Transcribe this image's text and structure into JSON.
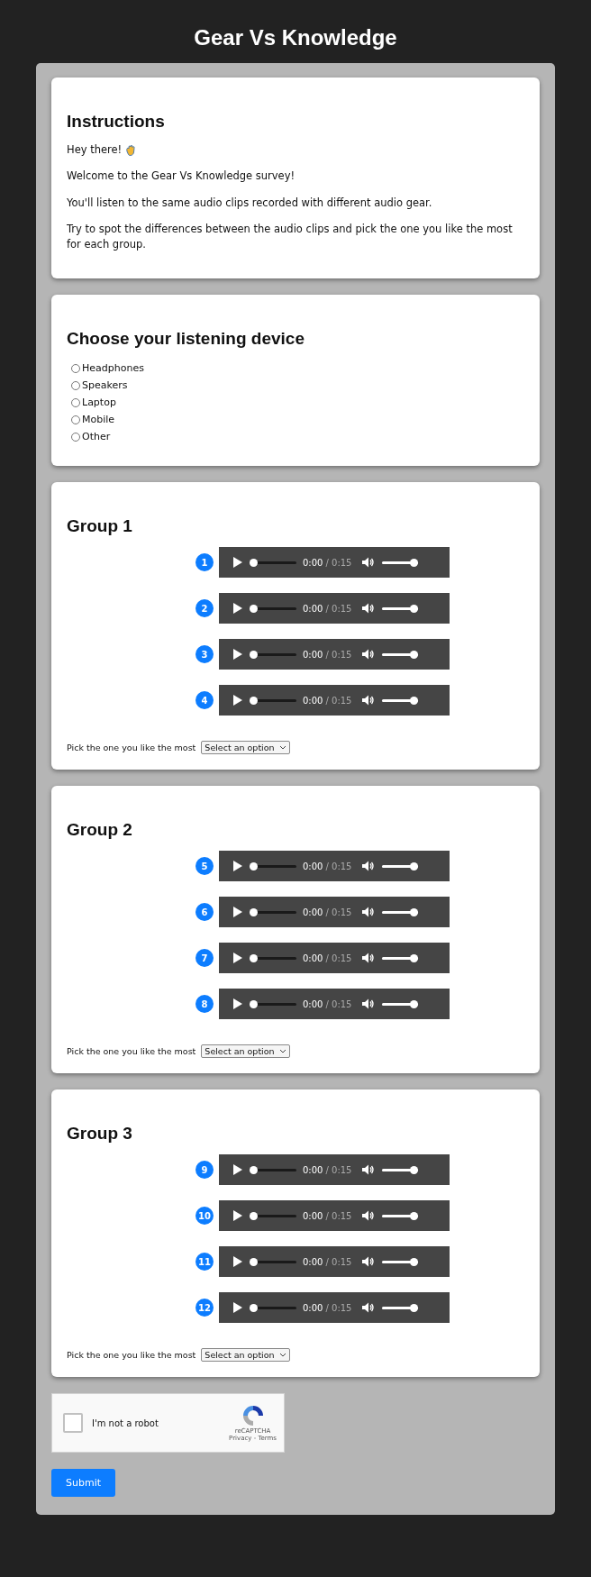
{
  "page_title": "Gear Vs Knowledge",
  "instructions": {
    "title": "Instructions",
    "greeting": "Hey there!",
    "paragraphs": [
      "Welcome to the Gear Vs Knowledge survey!",
      "You'll listen to the same audio clips recorded with different audio gear.",
      "Try to spot the differences between the audio clips and pick the one you like the most for each group."
    ]
  },
  "device": {
    "title": "Choose your listening device",
    "options": [
      {
        "label": "Headphones",
        "selected": false
      },
      {
        "label": "Speakers",
        "selected": false
      },
      {
        "label": "Laptop",
        "selected": false
      },
      {
        "label": "Mobile",
        "selected": false
      },
      {
        "label": "Other",
        "selected": false
      }
    ]
  },
  "groups": [
    {
      "title": "Group 1",
      "clips": [
        {
          "number": "1",
          "current": "0:00",
          "duration": "/ 0:15",
          "progress": {
            "level": 0
          },
          "volume": {
            "level": 1
          }
        },
        {
          "number": "2",
          "current": "0:00",
          "duration": "/ 0:15",
          "progress": {
            "level": 0
          },
          "volume": {
            "level": 1
          }
        },
        {
          "number": "3",
          "current": "0:00",
          "duration": "/ 0:15",
          "progress": {
            "level": 0
          },
          "volume": {
            "level": 1
          }
        },
        {
          "number": "4",
          "current": "0:00",
          "duration": "/ 0:15",
          "progress": {
            "level": 0
          },
          "volume": {
            "level": 1
          }
        }
      ],
      "pick_label": "Pick the one you like the most",
      "select": "Select an option"
    },
    {
      "title": "Group 2",
      "clips": [
        {
          "number": "5",
          "current": "0:00",
          "duration": "/ 0:15",
          "progress": {
            "level": 0
          },
          "volume": {
            "level": 1
          }
        },
        {
          "number": "6",
          "current": "0:00",
          "duration": "/ 0:15",
          "progress": {
            "level": 0
          },
          "volume": {
            "level": 1
          }
        },
        {
          "number": "7",
          "current": "0:00",
          "duration": "/ 0:15",
          "progress": {
            "level": 0
          },
          "volume": {
            "level": 1
          }
        },
        {
          "number": "8",
          "current": "0:00",
          "duration": "/ 0:15",
          "progress": {
            "level": 0
          },
          "volume": {
            "level": 1
          }
        }
      ],
      "pick_label": "Pick the one you like the most",
      "select": "Select an option"
    },
    {
      "title": "Group 3",
      "clips": [
        {
          "number": "9",
          "current": "0:00",
          "duration": "/ 0:15",
          "progress": {
            "level": 0
          },
          "volume": {
            "level": 1
          }
        },
        {
          "number": "10",
          "current": "0:00",
          "duration": "/ 0:15",
          "progress": {
            "level": 0
          },
          "volume": {
            "level": 1
          }
        },
        {
          "number": "11",
          "current": "0:00",
          "duration": "/ 0:15",
          "progress": {
            "level": 0
          },
          "volume": {
            "level": 1
          }
        },
        {
          "number": "12",
          "current": "0:00",
          "duration": "/ 0:15",
          "progress": {
            "level": 0
          },
          "volume": {
            "level": 1
          }
        }
      ],
      "pick_label": "Pick the one you like the most",
      "select": "Select an option"
    }
  ],
  "captcha": {
    "label": "I'm not a robot",
    "checked": false,
    "brand": "reCAPTCHA",
    "links": "Privacy - Terms"
  },
  "submit": "Submit"
}
